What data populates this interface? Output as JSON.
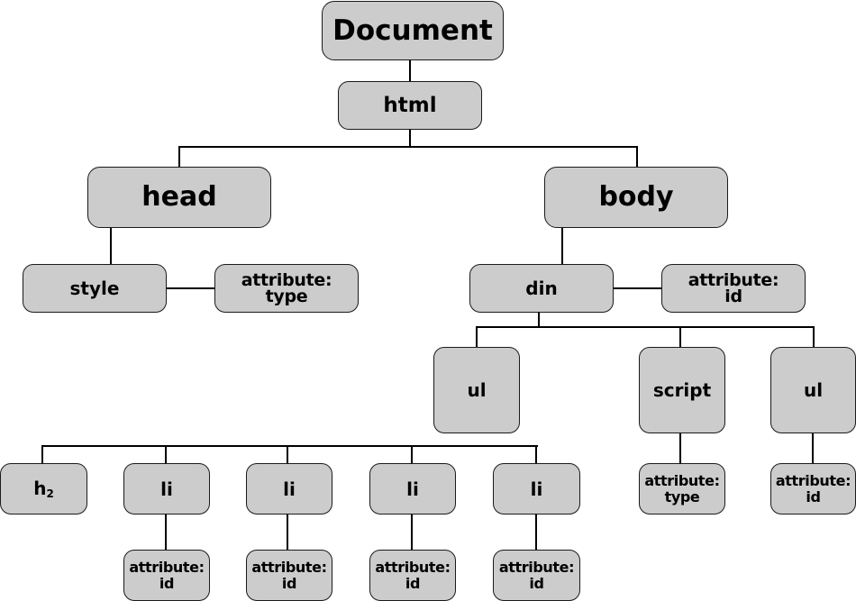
{
  "diagram": {
    "type": "DOM tree",
    "root": "Document",
    "nodes": {
      "document": "Document",
      "html": "html",
      "head": "head",
      "body": "body",
      "style": "style",
      "style_attr": "attribute:\ntype",
      "din": "din",
      "din_attr": "attribute:\nid",
      "ul_1": "ul",
      "script": "script",
      "script_attr": "attribute:\ntype",
      "ul_2": "ul",
      "ul_2_attr": "attribute:\nid",
      "h2": "h",
      "h2_sub": "2",
      "li_items": [
        {
          "label": "li",
          "attr": "attribute:\nid"
        },
        {
          "label": "li",
          "attr": "attribute:\nid"
        },
        {
          "label": "li",
          "attr": "attribute:\nid"
        },
        {
          "label": "li",
          "attr": "attribute:\nid"
        }
      ]
    },
    "edges": [
      [
        "Document",
        "html"
      ],
      [
        "html",
        "head"
      ],
      [
        "html",
        "body"
      ],
      [
        "head",
        "style"
      ],
      [
        "style",
        "attribute: type"
      ],
      [
        "body",
        "din"
      ],
      [
        "din",
        "attribute: id"
      ],
      [
        "din",
        "ul"
      ],
      [
        "din",
        "script"
      ],
      [
        "din",
        "ul"
      ],
      [
        "ul",
        "h2"
      ],
      [
        "ul",
        "li"
      ],
      [
        "ul",
        "li"
      ],
      [
        "ul",
        "li"
      ],
      [
        "ul",
        "li"
      ],
      [
        "li",
        "attribute: id"
      ],
      [
        "li",
        "attribute: id"
      ],
      [
        "li",
        "attribute: id"
      ],
      [
        "li",
        "attribute: id"
      ],
      [
        "script",
        "attribute: type"
      ],
      [
        "ul",
        "attribute: id"
      ]
    ],
    "colors": {
      "node_fill": "#cccccc",
      "node_border": "#1a1a1a",
      "line": "#000000",
      "background": "#ffffff"
    }
  }
}
